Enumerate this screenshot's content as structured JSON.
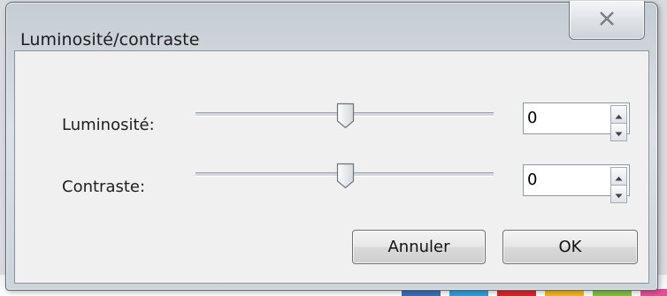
{
  "window": {
    "title": "Luminosité/contraste",
    "close_icon": "close-x-icon"
  },
  "brightness": {
    "label": "Luminosité:",
    "value": "0",
    "slider_level": 0.5
  },
  "contrast": {
    "label": "Contraste:",
    "value": "0",
    "slider_level": 0.5
  },
  "buttons": {
    "cancel": "Annuler",
    "ok": "OK"
  },
  "colors": {
    "accent_frame": "#5e6770",
    "client_bg": "#f0f0f0"
  }
}
